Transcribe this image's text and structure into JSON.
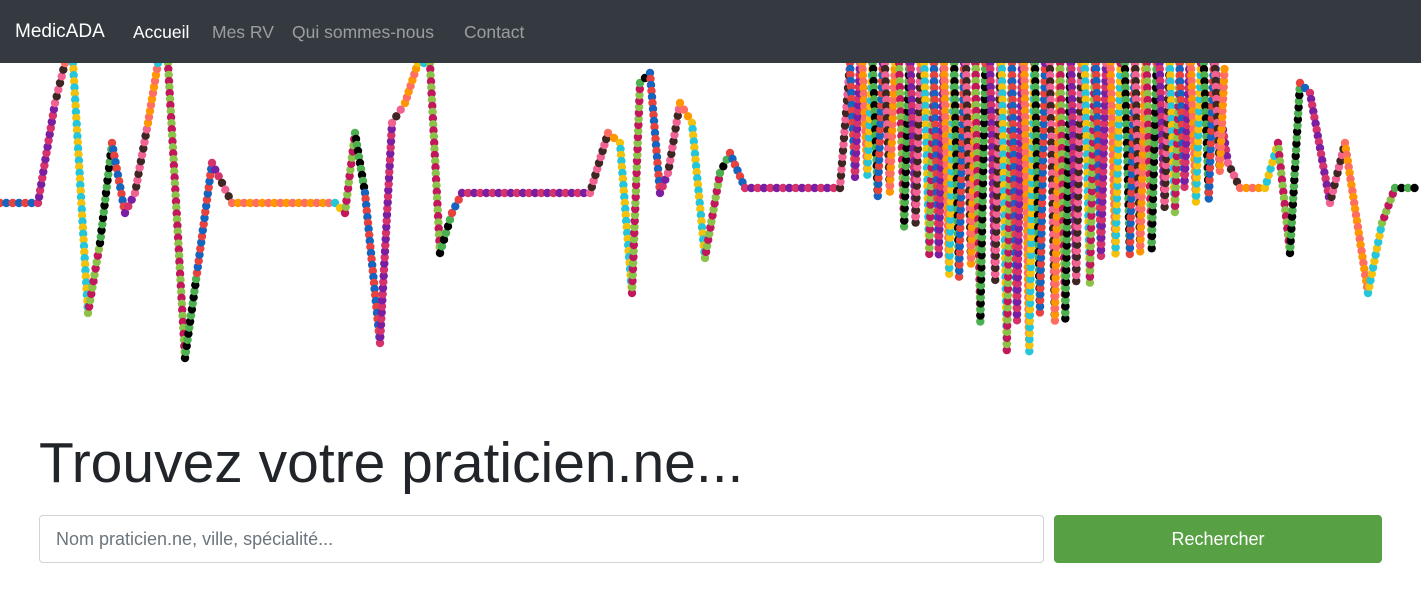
{
  "navbar": {
    "brand": "MedicADA",
    "links": [
      {
        "label": "Accueil",
        "active": true
      },
      {
        "label": "Mes RV",
        "active": false
      },
      {
        "label": "Qui sommes-nous",
        "active": false
      },
      {
        "label": "Contact",
        "active": false
      }
    ]
  },
  "hero": {
    "image": "colorful-heartbeat-ecg-line",
    "dot_colors": [
      "#e8423f",
      "#d6336c",
      "#f06292",
      "#ff6f61",
      "#f4c20d",
      "#8bc34a",
      "#4caf50",
      "#1565c0",
      "#7b1fa2",
      "#3e2723",
      "#ff9800",
      "#26c6da",
      "#c2185b",
      "#000000"
    ]
  },
  "main": {
    "headline": "Trouvez votre praticien.ne...",
    "search": {
      "placeholder": "Nom praticien.ne, ville, spécialité...",
      "button_label": "Rechercher"
    },
    "button_color": "#57a044"
  }
}
